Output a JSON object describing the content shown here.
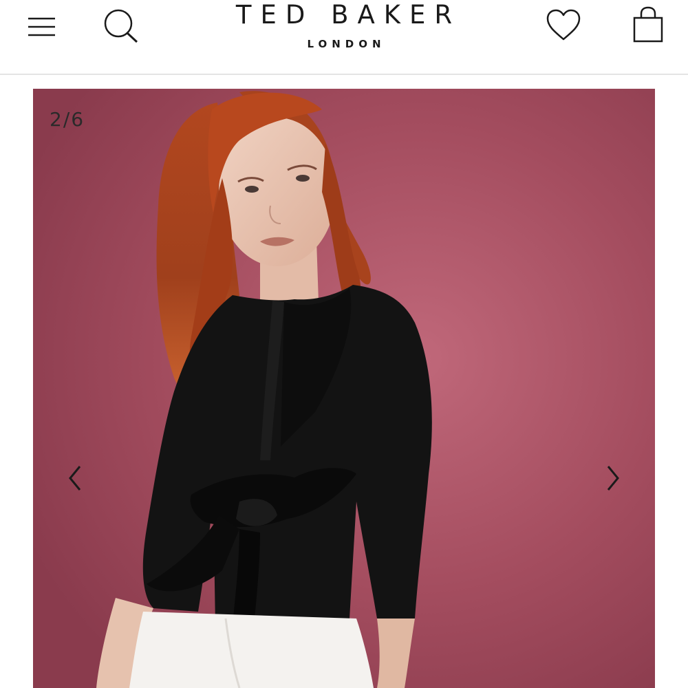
{
  "header": {
    "brand_name": "TED BAKER",
    "brand_location": "LONDON",
    "icons": {
      "menu": "hamburger-menu-icon",
      "search": "search-icon",
      "wishlist": "heart-icon",
      "bag": "shopping-bag-icon"
    }
  },
  "gallery": {
    "counter": "2/6",
    "current_image": 2,
    "total_images": 6,
    "icons": {
      "previous": "chevron-left-icon",
      "next": "chevron-right-icon"
    },
    "colors": {
      "background": "#a44d5f",
      "garment": "#111111"
    }
  }
}
